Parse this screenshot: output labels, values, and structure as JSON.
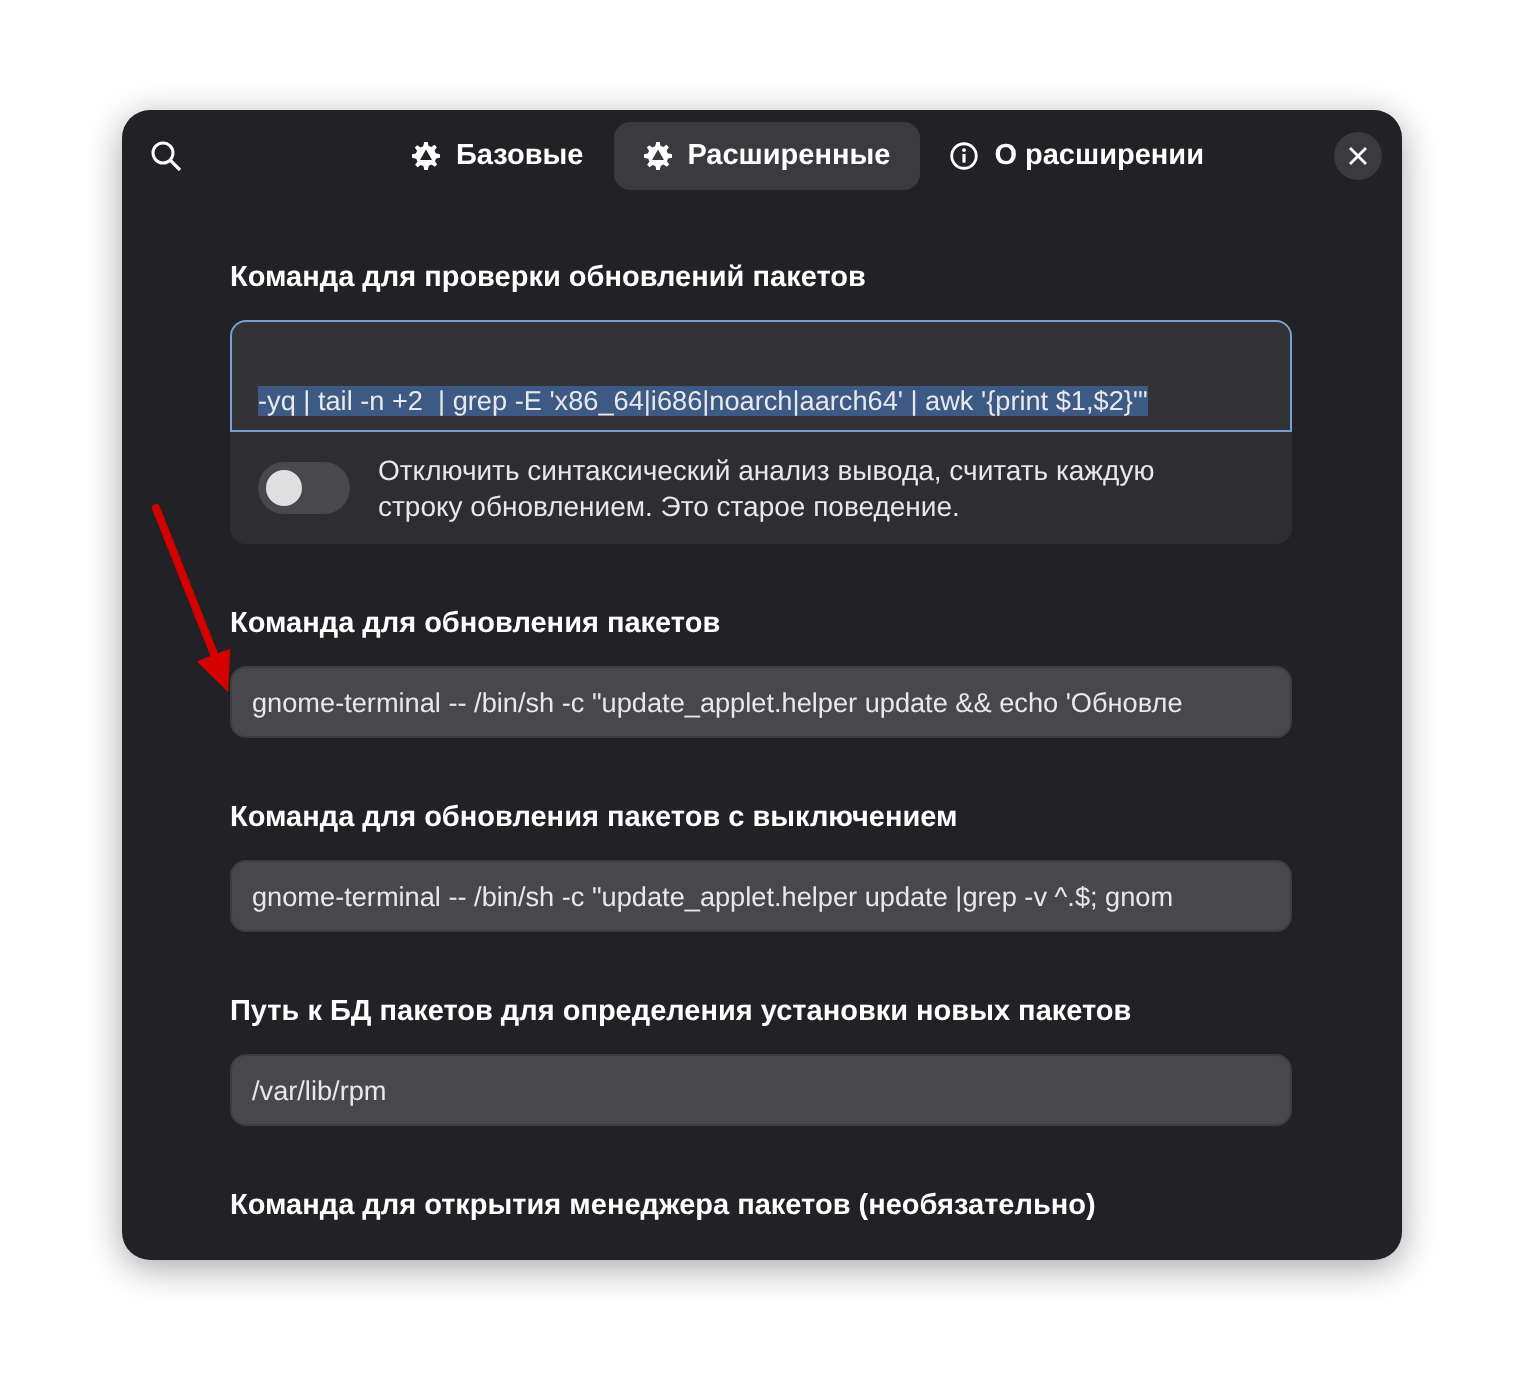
{
  "header": {
    "tabs": [
      {
        "label": "Базовые",
        "kind": "gear",
        "selected": false
      },
      {
        "label": "Расширенные",
        "kind": "gear",
        "selected": true
      },
      {
        "label": "О расширении",
        "kind": "info",
        "selected": false
      }
    ]
  },
  "settings": [
    {
      "kind": "area",
      "label": "Команда для проверки обновлений пакетов",
      "value": "-yq | tail -n +2  | grep -E 'x86_64|i686|noarch|aarch64' | awk '{print $1,$2}'\"",
      "focused": true,
      "text_selected": true,
      "option": {
        "label": "Отключить синтаксический анализ вывода, считать каждую строку обновлением. Это старое поведение.",
        "on": false
      }
    },
    {
      "kind": "field",
      "label": "Команда для обновления пакетов",
      "value": "gnome-terminal -- /bin/sh -c \"update_applet.helper update && echo 'Обновле",
      "focused": false,
      "text_selected": false
    },
    {
      "kind": "field",
      "label": "Команда для обновления пакетов с выключением",
      "value": "gnome-terminal -- /bin/sh -c \"update_applet.helper update |grep -v ^.$; gnom",
      "focused": false,
      "text_selected": false
    },
    {
      "kind": "field",
      "label": "Путь к БД пакетов для определения установки новых пакетов",
      "value": "/var/lib/rpm",
      "focused": false,
      "text_selected": false
    },
    {
      "kind": "label",
      "label": "Команда для открытия менеджера пакетов (необязательно)"
    }
  ],
  "annotations": [
    {
      "kind": "arrow",
      "color": "#d40000"
    }
  ]
}
